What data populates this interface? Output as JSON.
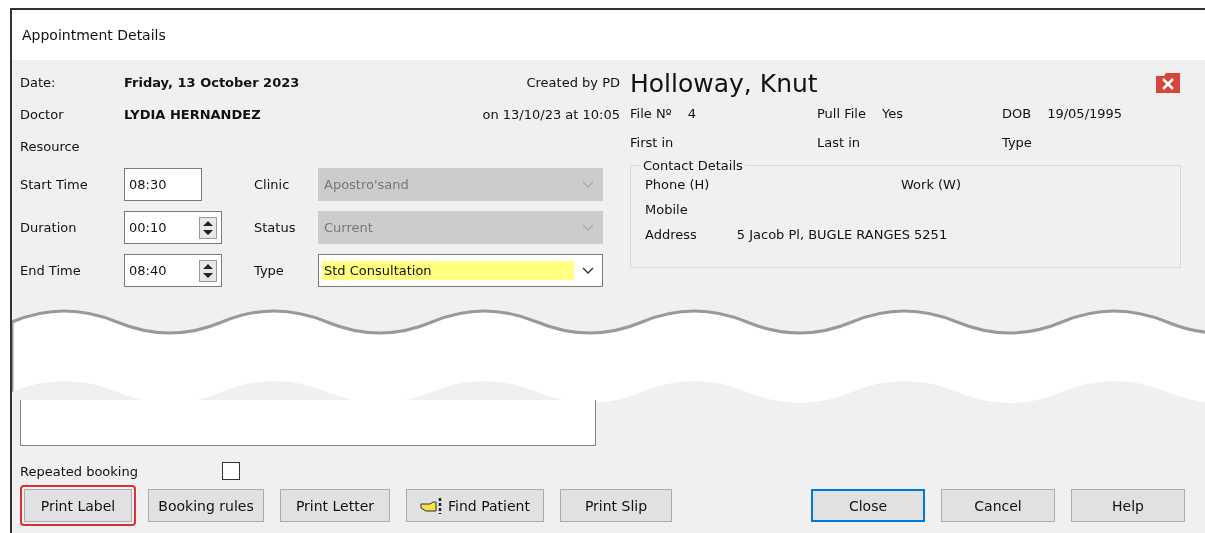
{
  "window": {
    "title": "Appointment Details"
  },
  "appointment": {
    "date_label": "Date:",
    "date": "Friday, 13 October 2023",
    "doctor_label": "Doctor",
    "doctor": "LYDIA HERNANDEZ",
    "resource_label": "Resource",
    "created_by": "Created by PD",
    "created_on": "on 13/10/23 at 10:05"
  },
  "fields": [
    {
      "label": "Start Time",
      "value": "08:30",
      "kind": "text",
      "select_label": "Clinic",
      "select_value": "Apostro'sand",
      "disabled": true,
      "highlighted": false
    },
    {
      "label": "Duration",
      "value": "00:10",
      "kind": "spinner",
      "select_label": "Status",
      "select_value": "Current",
      "disabled": true,
      "highlighted": false
    },
    {
      "label": "End Time",
      "value": "08:40",
      "kind": "spinner",
      "select_label": "Type",
      "select_value": "Std Consultation",
      "disabled": false,
      "highlighted": true
    }
  ],
  "patient": {
    "name": "Holloway, Knut",
    "info": [
      {
        "label": "File Nº",
        "value": "4"
      },
      {
        "label": "Pull File",
        "value": "Yes"
      },
      {
        "label": "DOB",
        "value": "19/05/1995"
      },
      {
        "label": "First in"
      },
      {
        "label": "Last in"
      },
      {
        "label": "Type"
      }
    ]
  },
  "contact": {
    "title": "Contact Details",
    "fields": [
      {
        "label": "Phone (H)"
      },
      {
        "label": "Work (W)"
      },
      {
        "label": "Mobile"
      },
      {
        "label": "Address",
        "value": "5 Jacob Pl,  BUGLE RANGES 5251"
      }
    ]
  },
  "repeated_booking": {
    "label": "Repeated booking",
    "checked": false
  },
  "buttons": [
    {
      "label": "Print Label",
      "highlighted": true,
      "icon": false
    },
    {
      "label": "Booking rules",
      "highlighted": false,
      "icon": false
    },
    {
      "label": "Print Letter",
      "highlighted": false,
      "icon": false
    },
    {
      "label": "Find Patient",
      "highlighted": false,
      "icon": true
    },
    {
      "label": "Print Slip",
      "highlighted": false,
      "icon": false
    }
  ],
  "dialog_buttons": [
    {
      "label": "Close",
      "default": true
    },
    {
      "label": "Cancel",
      "default": false
    },
    {
      "label": "Help",
      "default": false
    }
  ]
}
